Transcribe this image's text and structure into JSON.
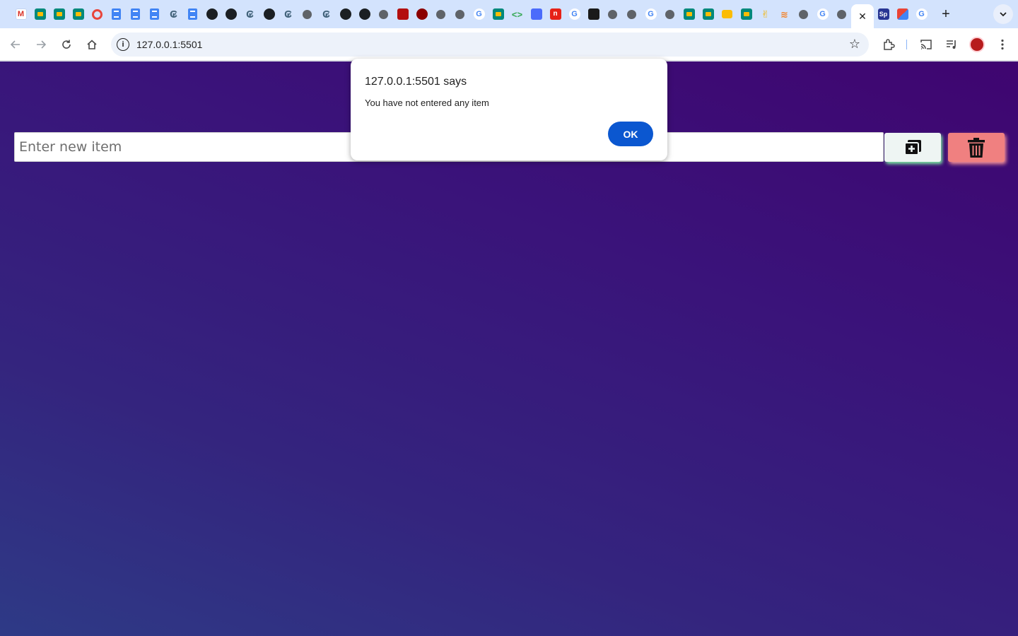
{
  "browser": {
    "url": "127.0.0.1:5501",
    "tabs": [
      {
        "icon": "gmail-icon",
        "glyph": "M"
      },
      {
        "icon": "meet-icon",
        "glyph": ""
      },
      {
        "icon": "meet-icon",
        "glyph": ""
      },
      {
        "icon": "meet-icon",
        "glyph": ""
      },
      {
        "icon": "ring-icon",
        "glyph": ""
      },
      {
        "icon": "docs-icon",
        "glyph": ""
      },
      {
        "icon": "docs-icon",
        "glyph": ""
      },
      {
        "icon": "docs-icon",
        "glyph": ""
      },
      {
        "icon": "ghost-icon",
        "glyph": "₢"
      },
      {
        "icon": "docs-icon",
        "glyph": ""
      },
      {
        "icon": "github-icon",
        "glyph": ""
      },
      {
        "icon": "github-icon",
        "glyph": ""
      },
      {
        "icon": "ghost-icon",
        "glyph": "₢"
      },
      {
        "icon": "github-icon",
        "glyph": ""
      },
      {
        "icon": "ghost-icon",
        "glyph": "₢"
      },
      {
        "icon": "globe-icon",
        "glyph": ""
      },
      {
        "icon": "ghost-icon",
        "glyph": "₢"
      },
      {
        "icon": "github-icon",
        "glyph": ""
      },
      {
        "icon": "github-icon",
        "glyph": ""
      },
      {
        "icon": "globe-icon",
        "glyph": ""
      },
      {
        "icon": "mask-icon",
        "glyph": ""
      },
      {
        "icon": "darkred-icon",
        "glyph": ""
      },
      {
        "icon": "globe-icon",
        "glyph": ""
      },
      {
        "icon": "globe-icon",
        "glyph": ""
      },
      {
        "icon": "google-icon",
        "glyph": "G"
      },
      {
        "icon": "meet-icon",
        "glyph": ""
      },
      {
        "icon": "code-icon",
        "glyph": "<>"
      },
      {
        "icon": "blue-icon",
        "glyph": ""
      },
      {
        "icon": "n-icon",
        "glyph": "n"
      },
      {
        "icon": "google-icon",
        "glyph": "G"
      },
      {
        "icon": "doc-dark-icon",
        "glyph": ""
      },
      {
        "icon": "globe-icon",
        "glyph": ""
      },
      {
        "icon": "globe-icon",
        "glyph": ""
      },
      {
        "icon": "google-icon",
        "glyph": "G"
      },
      {
        "icon": "globe-icon",
        "glyph": ""
      },
      {
        "icon": "meet-icon",
        "glyph": ""
      },
      {
        "icon": "meet-icon",
        "glyph": ""
      },
      {
        "icon": "slides-icon",
        "glyph": ""
      },
      {
        "icon": "meet-icon",
        "glyph": ""
      },
      {
        "icon": "hand-icon",
        "glyph": "✌"
      },
      {
        "icon": "stackoverflow-icon",
        "glyph": "≋"
      },
      {
        "icon": "globe-icon",
        "glyph": ""
      },
      {
        "icon": "google-icon",
        "glyph": "G"
      },
      {
        "icon": "globe-icon",
        "glyph": ""
      },
      {
        "icon": "close-icon",
        "glyph": "✕",
        "active": true
      },
      {
        "icon": "sp-icon",
        "glyph": "Sp"
      },
      {
        "icon": "puzzle-icon",
        "glyph": ""
      },
      {
        "icon": "google-icon",
        "glyph": "G"
      }
    ],
    "new_tab": "+",
    "tab_search": "⌄"
  },
  "app": {
    "input_placeholder": "Enter new item",
    "input_value": ""
  },
  "alert": {
    "title": "127.0.0.1:5501 says",
    "message": "You have not entered any item",
    "ok_label": "OK"
  }
}
